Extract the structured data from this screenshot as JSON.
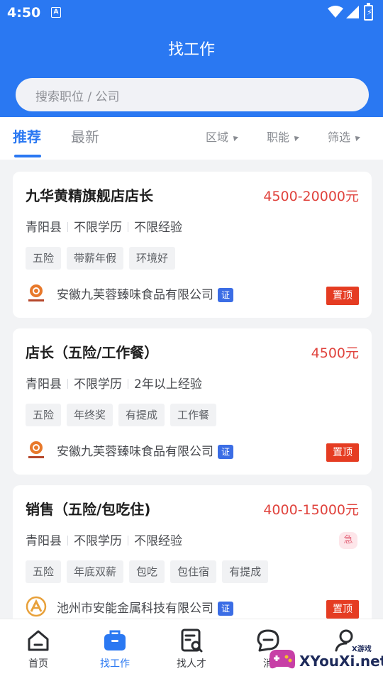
{
  "status": {
    "time": "4:50",
    "notification_icon": "A"
  },
  "header": {
    "title": "找工作",
    "search_placeholder": "搜索职位 / 公司"
  },
  "tabs": [
    {
      "label": "推荐"
    },
    {
      "label": "最新"
    }
  ],
  "filters": [
    {
      "label": "区域"
    },
    {
      "label": "职能"
    },
    {
      "label": "筛选"
    }
  ],
  "jobs": [
    {
      "title": "九华黄精旗舰店店长",
      "salary": "4500-20000元",
      "location": "青阳县",
      "education": "不限学历",
      "experience": "不限经验",
      "tags": [
        "五险",
        "带薪年假",
        "环境好"
      ],
      "company": "安徽九芙蓉臻味食品有限公司",
      "cert": "证",
      "badge": "置顶"
    },
    {
      "title": "店长（五险/工作餐）",
      "salary": "4500元",
      "location": "青阳县",
      "education": "不限学历",
      "experience": "2年以上经验",
      "tags": [
        "五险",
        "年终奖",
        "有提成",
        "工作餐"
      ],
      "company": "安徽九芙蓉臻味食品有限公司",
      "cert": "证",
      "badge": "置顶"
    },
    {
      "title": "销售（五险/包吃住)",
      "salary": "4000-15000元",
      "location": "青阳县",
      "education": "不限学历",
      "experience": "不限经验",
      "urgent": "急",
      "tags": [
        "五险",
        "年底双薪",
        "包吃",
        "包住宿",
        "有提成"
      ],
      "company": "池州市安能金属科技有限公司",
      "cert": "证",
      "badge": "置顶"
    }
  ],
  "nav": [
    {
      "label": "首页"
    },
    {
      "label": "找工作"
    },
    {
      "label": "找人才"
    },
    {
      "label": "消"
    }
  ],
  "watermark": {
    "small": "X游戏",
    "text": "XYouXi.net"
  },
  "colors": {
    "primary": "#2a78f2",
    "salary": "#e0433d",
    "pin": "#e53c22",
    "cert": "#3b6de5"
  }
}
